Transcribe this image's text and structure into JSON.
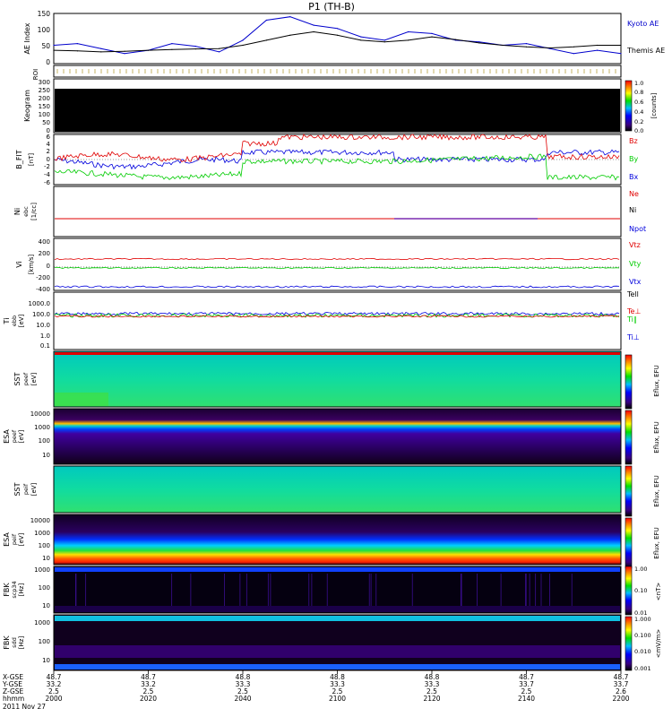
{
  "title": "P1 (TH-B)",
  "colors": {
    "red": "#e00000",
    "green": "#00cc00",
    "blue": "#0000dd",
    "black": "#000000",
    "panel_bg": "#000000",
    "ae_kyoto": "#0000cc",
    "ae_themis": "#000000"
  },
  "panels": {
    "ae": {
      "ylabel": "AE Index",
      "yticks": [
        "150",
        "100",
        "50",
        "0"
      ],
      "legend": [
        {
          "label": "Kyoto AE",
          "color": "#0000cc"
        },
        {
          "label": "Themis AE",
          "color": "#000000"
        }
      ]
    },
    "roi": {
      "ylabel": "ROI"
    },
    "keogram": {
      "ylabel": "Keogram",
      "yticks": [
        "300",
        "250",
        "200",
        "150",
        "100",
        "50",
        "0"
      ],
      "colorbar_ticks": [
        "1.0",
        "0.8",
        "0.6",
        "0.4",
        "0.2",
        "0.0"
      ],
      "colorbar_label": "[counts]"
    },
    "bfit": {
      "ylabel": "B_FIT",
      "units": "[nT]",
      "yticks": [
        "6",
        "4",
        "2",
        "0",
        "-2",
        "-4",
        "-6"
      ],
      "legend": [
        {
          "label": "Bz",
          "color": "#e00000"
        },
        {
          "label": "By",
          "color": "#00cc00"
        },
        {
          "label": "Bx",
          "color": "#0000dd"
        }
      ]
    },
    "density": {
      "ylabel": "Ni",
      "units": "[1/cc]",
      "sub": "ebc",
      "legend": [
        {
          "label": "Ne",
          "color": "#e00000"
        },
        {
          "label": "Ni",
          "color": "#000000"
        },
        {
          "label": "Npot",
          "color": "#0000dd"
        }
      ]
    },
    "velocity": {
      "ylabel": "Vi",
      "units": "[km/s]",
      "yticks": [
        "400",
        "200",
        "0",
        "-200",
        "-400"
      ],
      "legend": [
        {
          "label": "Vtz",
          "color": "#e00000"
        },
        {
          "label": "Vty",
          "color": "#00cc00"
        },
        {
          "label": "Vtx",
          "color": "#0000dd"
        }
      ]
    },
    "temperature": {
      "ylabel": "Ti",
      "units": "[eV]",
      "sub": "ebb",
      "yticks": [
        "1000.0",
        "100.0",
        "10.0",
        "1.0",
        "0.1"
      ],
      "legend": [
        {
          "label": "Tell",
          "color": "#000000"
        },
        {
          "label": "Te⊥",
          "color": "#e00000"
        },
        {
          "label": "Ti∥",
          "color": "#00cc00"
        },
        {
          "label": "Ti⊥",
          "color": "#0000dd"
        }
      ]
    },
    "sst_e": {
      "ylabel": "SST",
      "units": "[eV]",
      "sub": "peef",
      "colorbar_label": "Eflux, EFU"
    },
    "esa_e": {
      "ylabel": "ESA",
      "units": "[eV]",
      "sub": "peef",
      "yticks": [
        "10000",
        "1000",
        "100",
        "10"
      ],
      "colorbar_label": "Eflux, EFU"
    },
    "sst_i": {
      "ylabel": "SST",
      "units": "[eV]",
      "sub": "peif",
      "colorbar_label": "Eflux, EFU"
    },
    "esa_i": {
      "ylabel": "ESA",
      "units": "[eV]",
      "sub": "peif",
      "yticks": [
        "10000",
        "1000",
        "100",
        "10"
      ],
      "colorbar_label": "Eflux, EFU"
    },
    "fbk_b": {
      "ylabel": "FBK",
      "units": "[Hz]",
      "sub": "scp34",
      "yticks": [
        "1000",
        "100",
        "10"
      ],
      "colorbar_ticks": [
        "1.00",
        "0.10",
        "0.01"
      ],
      "colorbar_label": "<nT>"
    },
    "fbk_e": {
      "ylabel": "FBK",
      "units": "[Hz]",
      "sub": "sdd",
      "yticks": [
        "1000",
        "100",
        "10"
      ],
      "colorbar_ticks": [
        "1.000",
        "0.100",
        "0.010",
        "0.001"
      ],
      "colorbar_label": "<mV/m>"
    }
  },
  "time_axis": {
    "row_labels": [
      "X-GSE",
      "Y-GSE",
      "Z-GSE",
      "hhmm",
      "2011 Nov 27"
    ],
    "columns": [
      {
        "x": "48.7",
        "y": "33.2",
        "z": "2.5",
        "t": "2000"
      },
      {
        "x": "48.7",
        "y": "33.2",
        "z": "2.5",
        "t": "2020"
      },
      {
        "x": "48.8",
        "y": "33.3",
        "z": "2.5",
        "t": "2040"
      },
      {
        "x": "48.8",
        "y": "33.3",
        "z": "2.5",
        "t": "2100"
      },
      {
        "x": "48.8",
        "y": "33.3",
        "z": "2.5",
        "t": "2120"
      },
      {
        "x": "48.7",
        "y": "33.7",
        "z": "2.5",
        "t": "2140"
      },
      {
        "x": "48.7",
        "y": "33.7",
        "z": "2.6",
        "t": "2200"
      }
    ]
  },
  "chart_data": {
    "type": "line",
    "title": "P1 (TH-B)",
    "xlabel": "hhmm",
    "x_range": [
      "2000",
      "2200"
    ],
    "series": [
      {
        "name": "Kyoto AE",
        "x": [
          "2000",
          "2005",
          "2010",
          "2015",
          "2020",
          "2025",
          "2030",
          "2035",
          "2040",
          "2045",
          "2050",
          "2055",
          "2100",
          "2105",
          "2110",
          "2115",
          "2120",
          "2125",
          "2130",
          "2135",
          "2140",
          "2145",
          "2150",
          "2155",
          "2200"
        ],
        "values": [
          55,
          60,
          45,
          30,
          40,
          60,
          52,
          35,
          70,
          130,
          140,
          115,
          105,
          80,
          70,
          95,
          90,
          70,
          65,
          55,
          60,
          45,
          30,
          40,
          30
        ]
      },
      {
        "name": "Themis AE",
        "x": [
          "2000",
          "2005",
          "2010",
          "2015",
          "2020",
          "2025",
          "2030",
          "2035",
          "2040",
          "2045",
          "2050",
          "2055",
          "2100",
          "2105",
          "2110",
          "2115",
          "2120",
          "2125",
          "2130",
          "2135",
          "2140",
          "2145",
          "2150",
          "2155",
          "2200"
        ],
        "values": [
          40,
          38,
          35,
          37,
          40,
          42,
          44,
          45,
          55,
          70,
          85,
          95,
          85,
          70,
          65,
          70,
          80,
          72,
          62,
          55,
          50,
          47,
          50,
          55,
          55
        ]
      }
    ],
    "ylim": [
      0,
      150
    ]
  }
}
